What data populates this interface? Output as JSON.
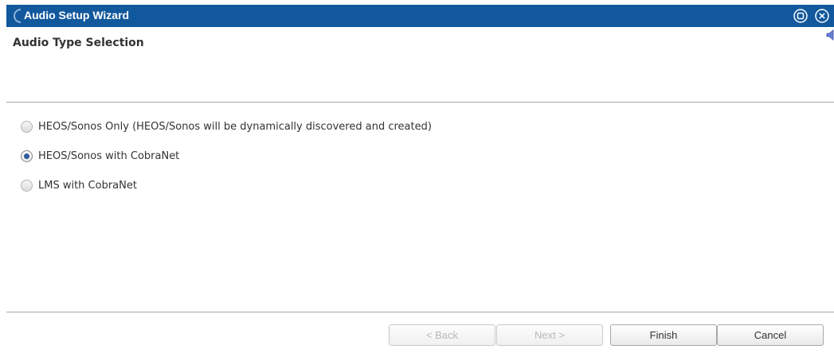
{
  "window": {
    "title": "Audio Setup Wizard",
    "icons": [
      "app-logo-icon",
      "restore-icon",
      "close-icon",
      "speaker-icon"
    ],
    "accent_color": "#12589c"
  },
  "page": {
    "title": "Audio Type Selection"
  },
  "options": [
    {
      "label": "HEOS/Sonos Only (HEOS/Sonos will be dynamically discovered and created)",
      "checked": false
    },
    {
      "label": "HEOS/Sonos with CobraNet",
      "checked": true
    },
    {
      "label": "LMS with CobraNet",
      "checked": false
    }
  ],
  "footer": {
    "back_label": "< Back",
    "next_label": "Next >",
    "finish_label": "Finish",
    "cancel_label": "Cancel",
    "back_enabled": false,
    "next_enabled": false
  }
}
